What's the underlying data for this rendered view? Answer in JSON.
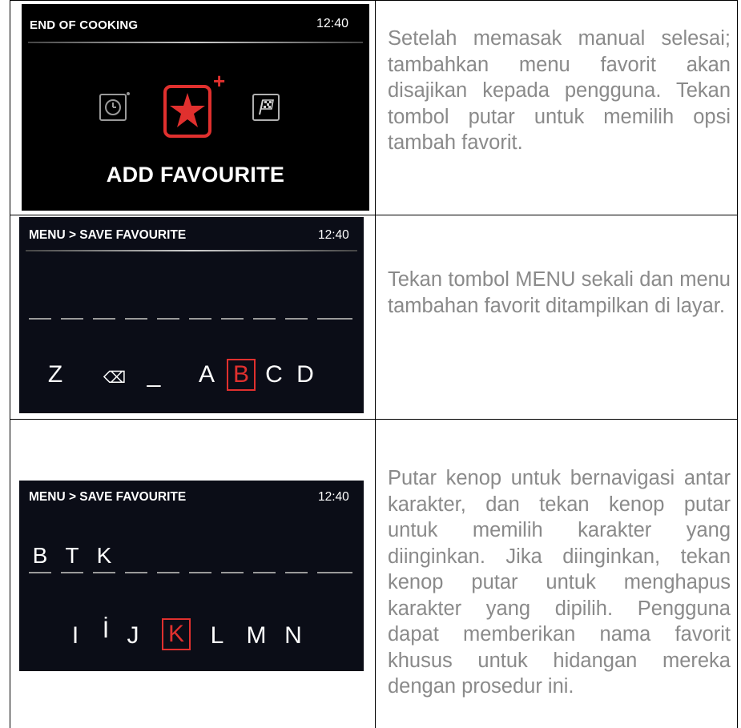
{
  "rows": [
    {
      "screen": {
        "title": "END OF COOKING",
        "time": "12:40",
        "options": [
          {
            "icon": "timer-icon",
            "selected": false
          },
          {
            "icon": "star-icon",
            "selected": true
          },
          {
            "icon": "finish-flag-icon",
            "selected": false
          }
        ],
        "plus": "+",
        "action_label": "ADD FAVOURITE",
        "accent": "#e0302e"
      },
      "description": "Setelah memasak manual selesai; tambahkan menu favorit akan disajikan kepada pengguna. Tekan tombol putar untuk memilih opsi tambah favorit."
    },
    {
      "screen": {
        "title": "MENU > SAVE FAVOURITE",
        "time": "12:40",
        "entered": [
          "",
          "",
          "",
          "",
          "",
          "",
          "",
          "",
          "",
          ""
        ],
        "characters": [
          "Z",
          "⌫",
          "_",
          "A",
          "B",
          "C",
          "D"
        ],
        "selected_character": "B",
        "accent": "#e0302e"
      },
      "description": "Tekan tombol MENU sekali dan menu tambahan favorit ditampilkan di layar."
    },
    {
      "screen": {
        "title": "MENU > SAVE FAVOURITE",
        "time": "12:40",
        "entered": [
          "B",
          "T",
          "K",
          "",
          "",
          "",
          "",
          "",
          "",
          ""
        ],
        "characters": [
          "I",
          "İ",
          "J",
          "K",
          "L",
          "M",
          "N"
        ],
        "selected_character": "K",
        "accent": "#e0302e"
      },
      "description": "Putar kenop untuk bernavigasi antar karakter, dan tekan kenop putar untuk memilih karakter yang diinginkan. Jika diinginkan, tekan kenop putar untuk menghapus karakter yang dipilih. Pengguna dapat memberikan nama favorit khusus untuk hidangan mereka dengan prosedur ini."
    }
  ]
}
